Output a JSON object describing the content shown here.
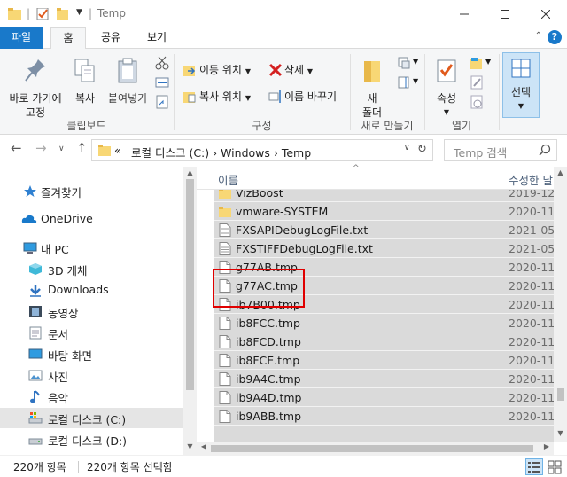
{
  "window": {
    "title": "Temp",
    "minimize_icon": "minimize-icon",
    "maximize_icon": "maximize-icon",
    "close_icon": "close-icon"
  },
  "ribbon_tabs": [
    {
      "label": "파일"
    },
    {
      "label": "홈"
    },
    {
      "label": "공유"
    },
    {
      "label": "보기"
    }
  ],
  "ribbon": {
    "clipboard": {
      "pin_label": "바로 가기에\n고정",
      "copy_label": "복사",
      "paste_label": "붙여넣기",
      "group_label": "클립보드"
    },
    "organize": {
      "move_label": "이동 위치",
      "copy_to_label": "복사 위치",
      "delete_label": "삭제",
      "rename_label": "이름 바꾸기",
      "group_label": "구성"
    },
    "new": {
      "new_folder_label": "새\n폴더",
      "group_label": "새로 만들기"
    },
    "open": {
      "properties_label": "속성",
      "group_label": "열기"
    },
    "select": {
      "select_label": "선택"
    }
  },
  "address": {
    "prefix": "«",
    "crumbs": "로컬 디스크 (C:)  ›  Windows  ›  Temp",
    "search_placeholder": "Temp 검색"
  },
  "nav": {
    "items": [
      {
        "label": "즐겨찾기",
        "icon": "star-icon"
      },
      {
        "label": "OneDrive",
        "icon": "cloud-icon"
      },
      {
        "label": "내 PC",
        "icon": "pc-icon"
      },
      {
        "label": "3D 개체",
        "icon": "3d-objects-icon"
      },
      {
        "label": "Downloads",
        "icon": "download-icon"
      },
      {
        "label": "동영상",
        "icon": "video-icon"
      },
      {
        "label": "문서",
        "icon": "document-icon"
      },
      {
        "label": "바탕 화면",
        "icon": "desktop-icon"
      },
      {
        "label": "사진",
        "icon": "picture-icon"
      },
      {
        "label": "음악",
        "icon": "music-icon"
      },
      {
        "label": "로컬 디스크 (C:)",
        "icon": "drive-c-icon"
      },
      {
        "label": "로컬 디스크 (D:)",
        "icon": "drive-d-icon"
      }
    ]
  },
  "filelist": {
    "col_name": "이름",
    "col_date": "수정한 날",
    "rows": [
      {
        "name": "VizBoost",
        "date": "2019-12",
        "type": "folder"
      },
      {
        "name": "vmware-SYSTEM",
        "date": "2020-11",
        "type": "folder"
      },
      {
        "name": "FXSAPIDebugLogFile.txt",
        "date": "2021-05",
        "type": "text"
      },
      {
        "name": "FXSTIFFDebugLogFile.txt",
        "date": "2021-05",
        "type": "text"
      },
      {
        "name": "g77AB.tmp",
        "date": "2020-11",
        "type": "file"
      },
      {
        "name": "g77AC.tmp",
        "date": "2020-11",
        "type": "file"
      },
      {
        "name": "ib7B00.tmp",
        "date": "2020-11",
        "type": "file"
      },
      {
        "name": "ib8FCC.tmp",
        "date": "2020-11",
        "type": "file"
      },
      {
        "name": "ib8FCD.tmp",
        "date": "2020-11",
        "type": "file"
      },
      {
        "name": "ib8FCE.tmp",
        "date": "2020-11",
        "type": "file"
      },
      {
        "name": "ib9A4C.tmp",
        "date": "2020-11",
        "type": "file"
      },
      {
        "name": "ib9A4D.tmp",
        "date": "2020-11",
        "type": "file"
      },
      {
        "name": "ib9ABB.tmp",
        "date": "2020-11",
        "type": "file"
      }
    ]
  },
  "status": {
    "count": "220개 항목",
    "selected": "220개 항목 선택함"
  },
  "colors": {
    "accent": "#1979ca",
    "selection": "#dadada",
    "highlight_box": "#e00000",
    "folder": "#f8d775"
  }
}
